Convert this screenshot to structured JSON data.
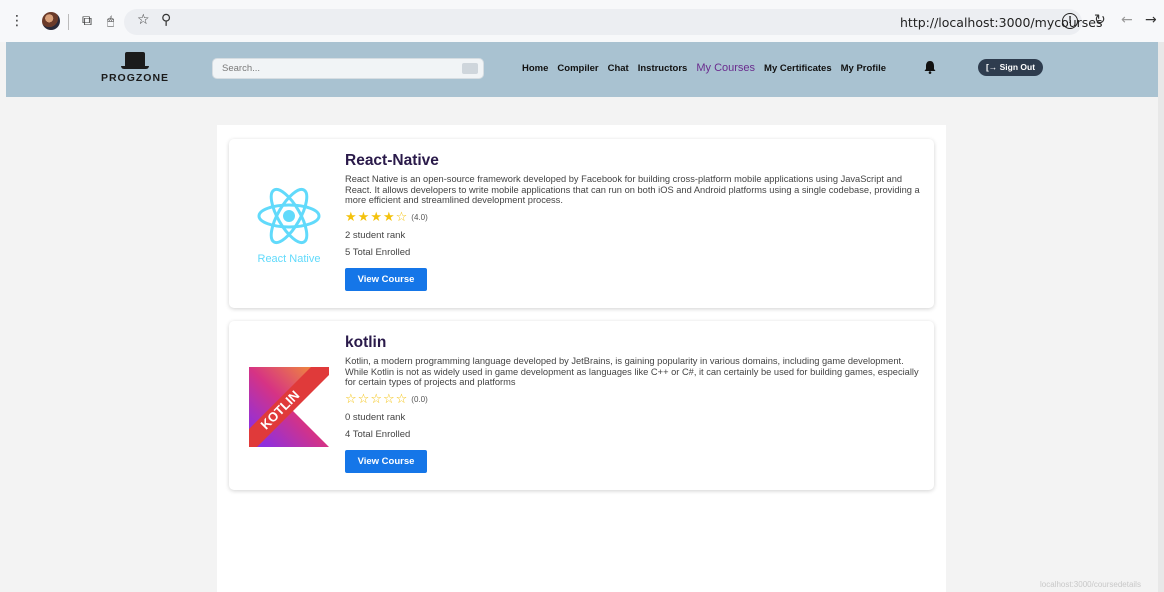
{
  "browser": {
    "url": "http://localhost:3000/mycourses",
    "status_text": "localhost:3000/coursedetails"
  },
  "nav": {
    "logo_text": "PROGZONE",
    "search_placeholder": "Search...",
    "links": [
      "Home",
      "Compiler",
      "Chat",
      "Instructors",
      "My Courses",
      "My Certificates",
      "My Profile"
    ],
    "active_link": "My Courses",
    "sign_out": "[→ Sign Out"
  },
  "courses": [
    {
      "title": "React-Native",
      "description": "React Native is an open-source framework developed by Facebook for building cross-platform mobile applications using JavaScript and React. It allows developers to write mobile applications that can run on both iOS and Android platforms using a single codebase, providing a more efficient and streamlined development process.",
      "stars_filled": 4,
      "rating": "(4.0)",
      "student_rank": "2 student rank",
      "enrolled": "5 Total Enrolled",
      "button": "View Course",
      "thumb_label": "React Native"
    },
    {
      "title": "kotlin",
      "description": "Kotlin, a modern programming language developed by JetBrains, is gaining popularity in various domains, including game development. While Kotlin is not as widely used in game development as languages like C++ or C#, it can certainly be used for building games, especially for certain types of projects and platforms",
      "stars_filled": 0,
      "rating": "(0.0)",
      "student_rank": "0 student rank",
      "enrolled": "4 Total Enrolled",
      "button": "View Course",
      "thumb_label": "KOTLIN"
    }
  ]
}
